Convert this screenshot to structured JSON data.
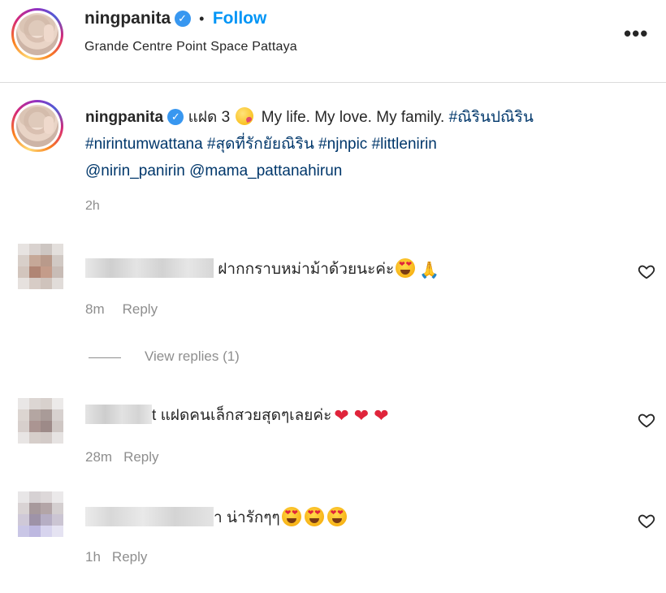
{
  "post_header": {
    "username": "ningpanita",
    "separator": "•",
    "follow_label": "Follow",
    "location": "Grande Centre Point Space Pattaya",
    "more_icon": "more-horizontal-icon"
  },
  "caption": {
    "username": "ningpanita",
    "text_thai": "แฝด 3",
    "text": "My life. My love. My family.",
    "hashtags": [
      "#ณิรินปณิริน",
      "#nirintumwattana",
      "#สุดที่รักยัยณิริน",
      "#njnpic",
      "#littlenirin"
    ],
    "mentions": [
      "@nirin_panirin",
      "@mama_pattanahirun"
    ],
    "time": "2h"
  },
  "comments": [
    {
      "name_fragment": "",
      "text": "ฝากกราบหม่าม้าด้วยนะค่ะ",
      "emojis": [
        "heart-eyes",
        "folded-hands"
      ],
      "time": "8m",
      "reply_label": "Reply",
      "view_replies": "View replies (1)"
    },
    {
      "name_fragment": "t",
      "text": "แฝดคนเล็กสวยสุดๆเลยค่ะ",
      "emojis": [
        "red-heart",
        "red-heart",
        "red-heart"
      ],
      "time": "28m",
      "reply_label": "Reply"
    },
    {
      "name_fragment": "า",
      "text": "น่ารักๆๆ",
      "emojis": [
        "heart-eyes",
        "heart-eyes",
        "heart-eyes"
      ],
      "time": "1h",
      "reply_label": "Reply"
    }
  ],
  "colors": {
    "link_blue": "#0095f6",
    "hashtag": "#00376b",
    "secondary_text": "#8e8e8e",
    "verified": "#3897f0"
  }
}
